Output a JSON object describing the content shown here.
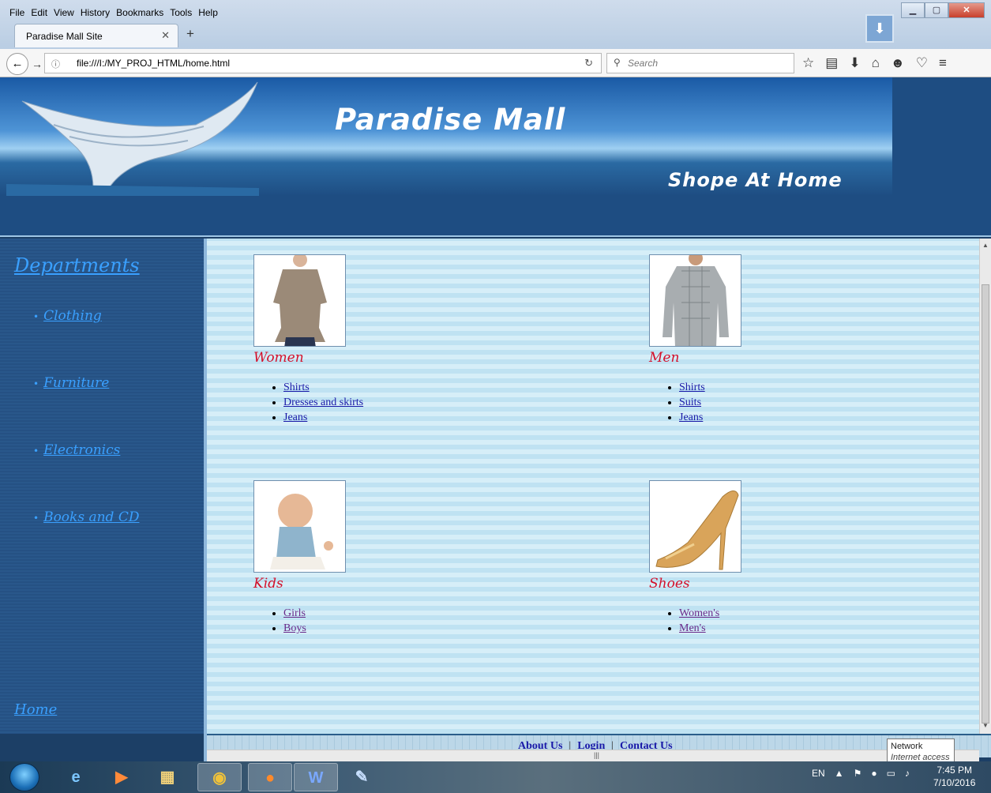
{
  "browser": {
    "menu": [
      "File",
      "Edit",
      "View",
      "History",
      "Bookmarks",
      "Tools",
      "Help"
    ],
    "tab_title": "Paradise Mall Site",
    "url": "file:///I:/MY_PROJ_HTML/home.html",
    "search_placeholder": "Search"
  },
  "site": {
    "title": "Paradise Mall",
    "tagline": "Shope At Home"
  },
  "sidebar": {
    "heading": "Departments",
    "items": [
      "Clothing",
      "Furniture",
      "Electronics",
      "Books and CD"
    ],
    "home": "Home"
  },
  "categories": [
    {
      "name": "Women",
      "image": "woman-blouse",
      "links": [
        "Shirts",
        "Dresses and skirts",
        "Jeans"
      ]
    },
    {
      "name": "Men",
      "image": "man-shirt",
      "links": [
        "Shirts",
        "Suits",
        "Jeans"
      ]
    },
    {
      "name": "Kids",
      "image": "baby",
      "links": [
        "Girls",
        "Boys"
      ]
    },
    {
      "name": "Shoes",
      "image": "high-heel-sandal",
      "links": [
        "Women's",
        "Men's"
      ]
    }
  ],
  "footer": {
    "about": "About Us",
    "login": "Login",
    "contact": "Contact Us"
  },
  "tooltip": {
    "title": "Network",
    "sub": "Internet access"
  },
  "taskbar": {
    "lang": "EN",
    "time": "7:45 PM",
    "date": "7/10/2016"
  },
  "colors": {
    "link": "#1a1aa8",
    "visited": "#6a2a8a",
    "category_heading": "#d4102a",
    "sidebar_link": "#3aa0ff",
    "sidebar_bg": "#234e80"
  }
}
